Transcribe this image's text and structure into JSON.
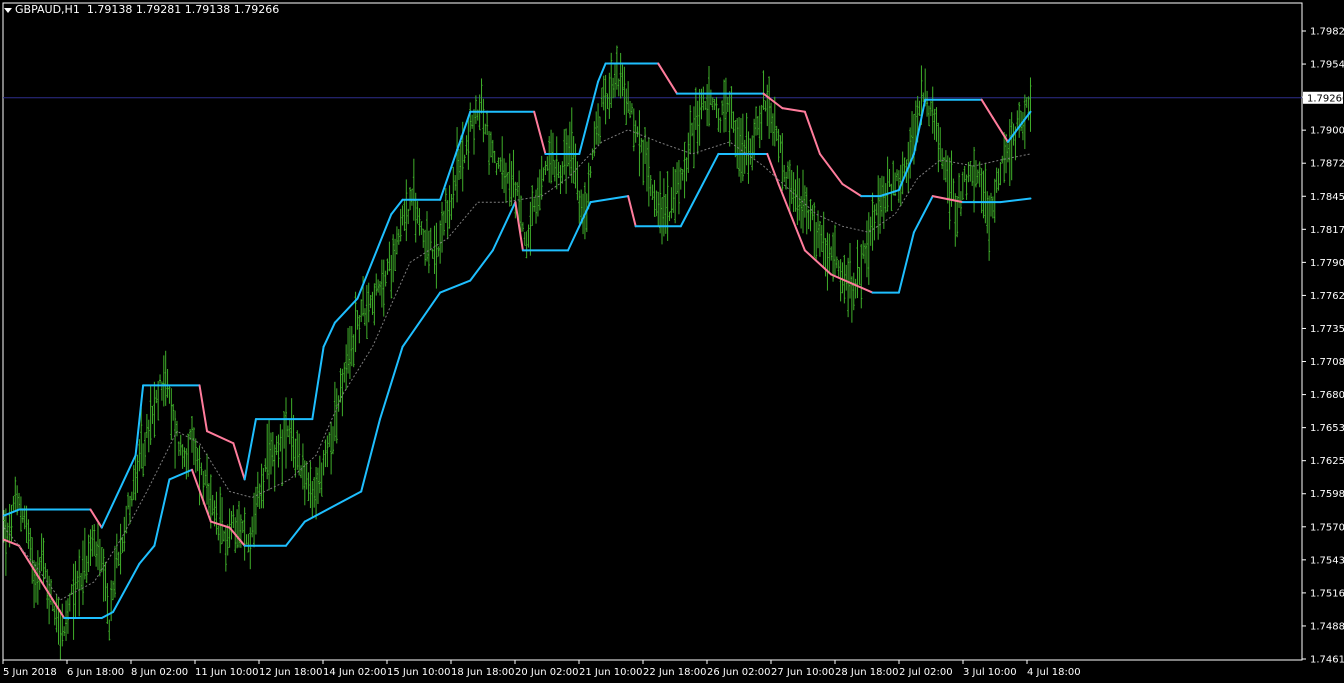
{
  "header": {
    "symbol": "GBPAUD,H1",
    "ohlc": "1.79138 1.79281 1.79138 1.79266"
  },
  "current_price_label": "1.79266",
  "colors": {
    "background": "#000000",
    "bars": "#3fae2a",
    "upper_band_up": "#1ebfff",
    "band_down": "#ff7c9c",
    "middle_line": "#7d7d7d",
    "price_line": "#2e2e8c",
    "axis": "#ffffff"
  },
  "chart_data": {
    "type": "line",
    "title": "GBPAUD,H1",
    "y_ticks": [
      "1.79820",
      "1.79545",
      "1.79266",
      "1.79000",
      "1.78725",
      "1.78450",
      "1.78175",
      "1.77900",
      "1.77625",
      "1.77350",
      "1.77080",
      "1.76805",
      "1.76530",
      "1.76255",
      "1.75980",
      "1.75705",
      "1.75430",
      "1.75160",
      "1.74885",
      "1.74610"
    ],
    "x_ticks": [
      "5 Jun 2018",
      "6 Jun 18:00",
      "8 Jun 02:00",
      "11 Jun 10:00",
      "12 Jun 18:00",
      "14 Jun 02:00",
      "15 Jun 10:00",
      "18 Jun 18:00",
      "20 Jun 02:00",
      "21 Jun 10:00",
      "22 Jun 18:00",
      "26 Jun 02:00",
      "27 Jun 10:00",
      "28 Jun 18:00",
      "2 Jul 02:00",
      "3 Jul 10:00",
      "4 Jul 18:00"
    ],
    "ylim": [
      1.7461,
      1.7997
    ],
    "current_price": 1.79266,
    "price_anchors": [
      [
        0,
        1.757
      ],
      [
        2,
        1.756
      ],
      [
        5,
        1.7585
      ],
      [
        8,
        1.759
      ],
      [
        12,
        1.7575
      ],
      [
        16,
        1.753
      ],
      [
        20,
        1.7545
      ],
      [
        24,
        1.7515
      ],
      [
        28,
        1.75
      ],
      [
        32,
        1.748
      ],
      [
        36,
        1.751
      ],
      [
        40,
        1.753
      ],
      [
        44,
        1.754
      ],
      [
        48,
        1.756
      ],
      [
        52,
        1.7535
      ],
      [
        56,
        1.749
      ],
      [
        60,
        1.7545
      ],
      [
        65,
        1.758
      ],
      [
        70,
        1.761
      ],
      [
        75,
        1.764
      ],
      [
        80,
        1.7665
      ],
      [
        85,
        1.77
      ],
      [
        90,
        1.766
      ],
      [
        95,
        1.763
      ],
      [
        100,
        1.764
      ],
      [
        106,
        1.761
      ],
      [
        112,
        1.7575
      ],
      [
        118,
        1.756
      ],
      [
        124,
        1.758
      ],
      [
        130,
        1.7555
      ],
      [
        136,
        1.76
      ],
      [
        140,
        1.762
      ],
      [
        146,
        1.764
      ],
      [
        152,
        1.7645
      ],
      [
        158,
        1.7625
      ],
      [
        164,
        1.759
      ],
      [
        170,
        1.762
      ],
      [
        176,
        1.766
      ],
      [
        182,
        1.77
      ],
      [
        188,
        1.774
      ],
      [
        194,
        1.776
      ],
      [
        200,
        1.7765
      ],
      [
        206,
        1.779
      ],
      [
        212,
        1.783
      ],
      [
        218,
        1.784
      ],
      [
        224,
        1.781
      ],
      [
        230,
        1.779
      ],
      [
        236,
        1.783
      ],
      [
        242,
        1.787
      ],
      [
        248,
        1.79
      ],
      [
        254,
        1.792
      ],
      [
        260,
        1.788
      ],
      [
        266,
        1.786
      ],
      [
        272,
        1.785
      ],
      [
        278,
        1.781
      ],
      [
        284,
        1.784
      ],
      [
        290,
        1.788
      ],
      [
        296,
        1.787
      ],
      [
        302,
        1.7885
      ],
      [
        308,
        1.782
      ],
      [
        314,
        1.789
      ],
      [
        320,
        1.793
      ],
      [
        326,
        1.795
      ],
      [
        332,
        1.792
      ],
      [
        338,
        1.789
      ],
      [
        344,
        1.786
      ],
      [
        350,
        1.783
      ],
      [
        356,
        1.784
      ],
      [
        362,
        1.787
      ],
      [
        368,
        1.791
      ],
      [
        374,
        1.7925
      ],
      [
        380,
        1.791
      ],
      [
        386,
        1.792
      ],
      [
        392,
        1.788
      ],
      [
        398,
        1.789
      ],
      [
        404,
        1.792
      ],
      [
        410,
        1.79
      ],
      [
        416,
        1.786
      ],
      [
        422,
        1.784
      ],
      [
        428,
        1.783
      ],
      [
        434,
        1.781
      ],
      [
        440,
        1.779
      ],
      [
        446,
        1.778
      ],
      [
        452,
        1.776
      ],
      [
        458,
        1.78
      ],
      [
        464,
        1.783
      ],
      [
        470,
        1.785
      ],
      [
        476,
        1.786
      ],
      [
        482,
        1.788
      ],
      [
        488,
        1.793
      ],
      [
        494,
        1.791
      ],
      [
        500,
        1.787
      ],
      [
        506,
        1.784
      ],
      [
        512,
        1.786
      ],
      [
        518,
        1.786
      ],
      [
        524,
        1.783
      ],
      [
        530,
        1.787
      ],
      [
        536,
        1.789
      ],
      [
        542,
        1.791
      ],
      [
        546,
        1.7926
      ]
    ],
    "upper_band": [
      [
        0,
        1.758
      ],
      [
        8,
        1.7585
      ],
      [
        46,
        1.7585
      ],
      [
        52,
        1.757
      ],
      [
        70,
        1.763
      ],
      [
        74,
        1.7688
      ],
      [
        104,
        1.7688
      ],
      [
        108,
        1.765
      ],
      [
        122,
        1.764
      ],
      [
        128,
        1.761
      ],
      [
        134,
        1.766
      ],
      [
        164,
        1.766
      ],
      [
        170,
        1.772
      ],
      [
        176,
        1.774
      ],
      [
        188,
        1.776
      ],
      [
        206,
        1.783
      ],
      [
        212,
        1.7842
      ],
      [
        232,
        1.7842
      ],
      [
        248,
        1.7915
      ],
      [
        282,
        1.7915
      ],
      [
        288,
        1.788
      ],
      [
        306,
        1.788
      ],
      [
        316,
        1.794
      ],
      [
        320,
        1.7955
      ],
      [
        348,
        1.7955
      ],
      [
        358,
        1.793
      ],
      [
        404,
        1.793
      ],
      [
        414,
        1.7918
      ],
      [
        426,
        1.7915
      ],
      [
        434,
        1.788
      ],
      [
        446,
        1.7855
      ],
      [
        456,
        1.7845
      ],
      [
        466,
        1.7845
      ],
      [
        476,
        1.785
      ],
      [
        484,
        1.788
      ],
      [
        490,
        1.7925
      ],
      [
        520,
        1.7925
      ],
      [
        526,
        1.791
      ],
      [
        534,
        1.789
      ],
      [
        546,
        1.7915
      ]
    ],
    "lower_band": [
      [
        0,
        1.756
      ],
      [
        8,
        1.7555
      ],
      [
        32,
        1.7495
      ],
      [
        52,
        1.7495
      ],
      [
        58,
        1.75
      ],
      [
        72,
        1.754
      ],
      [
        80,
        1.7555
      ],
      [
        88,
        1.761
      ],
      [
        100,
        1.7618
      ],
      [
        110,
        1.7575
      ],
      [
        120,
        1.757
      ],
      [
        128,
        1.7555
      ],
      [
        150,
        1.7555
      ],
      [
        160,
        1.7575
      ],
      [
        178,
        1.759
      ],
      [
        190,
        1.76
      ],
      [
        200,
        1.766
      ],
      [
        212,
        1.772
      ],
      [
        232,
        1.7765
      ],
      [
        248,
        1.7775
      ],
      [
        260,
        1.78
      ],
      [
        272,
        1.784
      ],
      [
        276,
        1.78
      ],
      [
        300,
        1.78
      ],
      [
        312,
        1.784
      ],
      [
        332,
        1.7845
      ],
      [
        336,
        1.782
      ],
      [
        360,
        1.782
      ],
      [
        370,
        1.785
      ],
      [
        380,
        1.788
      ],
      [
        406,
        1.788
      ],
      [
        412,
        1.7855
      ],
      [
        426,
        1.78
      ],
      [
        440,
        1.778
      ],
      [
        462,
        1.7765
      ],
      [
        476,
        1.7765
      ],
      [
        484,
        1.7815
      ],
      [
        494,
        1.7845
      ],
      [
        510,
        1.784
      ],
      [
        530,
        1.784
      ],
      [
        546,
        1.7843
      ]
    ],
    "middle_line": [
      [
        0,
        1.757
      ],
      [
        16,
        1.754
      ],
      [
        30,
        1.751
      ],
      [
        48,
        1.7525
      ],
      [
        62,
        1.756
      ],
      [
        76,
        1.76
      ],
      [
        92,
        1.765
      ],
      [
        104,
        1.764
      ],
      [
        120,
        1.76
      ],
      [
        132,
        1.7595
      ],
      [
        152,
        1.761
      ],
      [
        166,
        1.763
      ],
      [
        180,
        1.768
      ],
      [
        196,
        1.772
      ],
      [
        216,
        1.779
      ],
      [
        236,
        1.781
      ],
      [
        252,
        1.784
      ],
      [
        266,
        1.784
      ],
      [
        286,
        1.7845
      ],
      [
        300,
        1.786
      ],
      [
        318,
        1.789
      ],
      [
        332,
        1.79
      ],
      [
        348,
        1.789
      ],
      [
        366,
        1.788
      ],
      [
        386,
        1.789
      ],
      [
        404,
        1.787
      ],
      [
        418,
        1.785
      ],
      [
        432,
        1.783
      ],
      [
        446,
        1.782
      ],
      [
        460,
        1.7815
      ],
      [
        474,
        1.783
      ],
      [
        486,
        1.786
      ],
      [
        498,
        1.7875
      ],
      [
        516,
        1.787
      ],
      [
        530,
        1.7875
      ],
      [
        546,
        1.788
      ]
    ],
    "series": [
      {
        "name": "upper_band"
      },
      {
        "name": "lower_band"
      },
      {
        "name": "middle_line"
      }
    ]
  }
}
